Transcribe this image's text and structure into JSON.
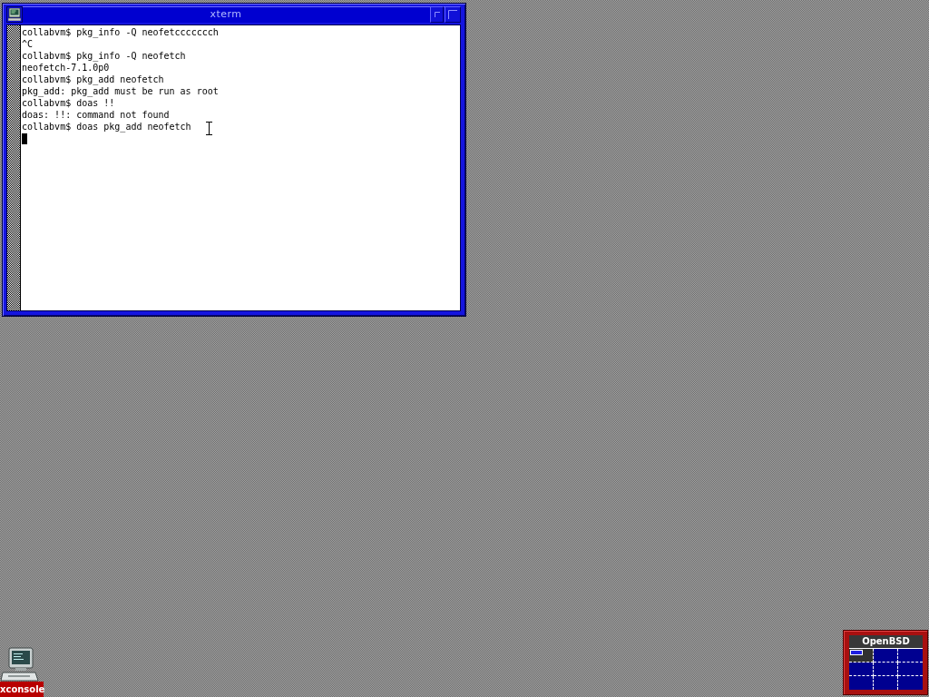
{
  "window": {
    "title": "xterm"
  },
  "terminal": {
    "lines": [
      "collabvm$ pkg_info -Q neofetccccccch",
      "^C",
      "collabvm$ pkg_info -Q neofetch",
      "neofetch-7.1.0p0",
      "collabvm$ pkg_add neofetch",
      "pkg_add: pkg_add must be run as root",
      "collabvm$ doas !!",
      "doas: !!: command not found",
      "collabvm$ doas pkg_add neofetch"
    ],
    "cursor_visible": true
  },
  "desktop_icons": [
    {
      "label": "xconsole"
    }
  ],
  "pager": {
    "title": "OpenBSD",
    "desks": [
      {
        "selected": true,
        "has_window": true
      },
      {
        "selected": false,
        "has_window": false
      },
      {
        "selected": false,
        "has_window": false
      },
      {
        "selected": false,
        "has_window": false
      },
      {
        "selected": false,
        "has_window": false
      },
      {
        "selected": false,
        "has_window": false
      },
      {
        "selected": false,
        "has_window": false
      },
      {
        "selected": false,
        "has_window": false
      },
      {
        "selected": false,
        "has_window": false
      }
    ]
  }
}
